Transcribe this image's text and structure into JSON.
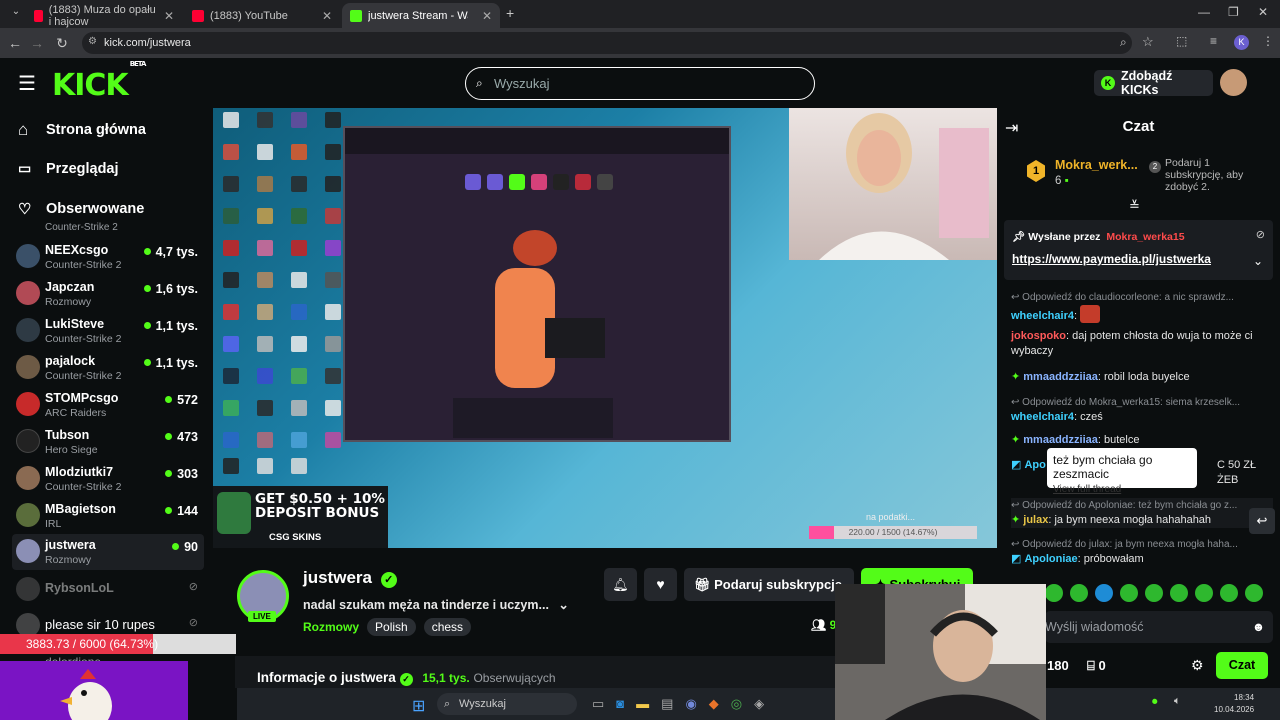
{
  "browser": {
    "tabs": [
      {
        "title": "(1883) Muza do opału i hajcow",
        "favicon_color": "#ff0033"
      },
      {
        "title": "(1883) YouTube",
        "favicon_color": "#ff0033"
      },
      {
        "title": "justwera Stream - Watch Li",
        "favicon_color": "#53fc18",
        "active": true
      }
    ],
    "url": "kick.com/justwera",
    "profile_letter": "K"
  },
  "header": {
    "logo": "KICK",
    "logo_badge": "BETA",
    "search_placeholder": "Wyszukaj",
    "get_kicks": "Zdobądź KICKs"
  },
  "sidebar": {
    "nav": [
      {
        "label": "Strona główna",
        "icon": "home-icon"
      },
      {
        "label": "Przeglądaj",
        "icon": "browse-icon"
      },
      {
        "label": "Obserwowane",
        "icon": "heart-icon"
      }
    ],
    "partial_top": "Counter-Strike 2",
    "channels": [
      {
        "name": "NEEXcsgo",
        "category": "Counter-Strike 2",
        "viewers": "4,7 tys.",
        "color": "#3a5068"
      },
      {
        "name": "Japczan",
        "category": "Rozmowy",
        "viewers": "1,6 tys.",
        "color": "#b14a55"
      },
      {
        "name": "LukiSteve",
        "category": "Counter-Strike 2",
        "viewers": "1,1 tys.",
        "color": "#2e3a44"
      },
      {
        "name": "pajalock",
        "category": "Counter-Strike 2",
        "viewers": "1,1 tys.",
        "color": "#6d5a45"
      },
      {
        "name": "STOMPcsgo",
        "category": "ARC Raiders",
        "viewers": "572",
        "color": "#c72a2a"
      },
      {
        "name": "Tubson",
        "category": "Hero Siege",
        "viewers": "473",
        "color": "#222"
      },
      {
        "name": "Mlodziutki7",
        "category": "Counter-Strike 2",
        "viewers": "303",
        "color": "#8a6a52"
      },
      {
        "name": "MBagietson",
        "category": "IRL",
        "viewers": "144",
        "color": "#5a6d3b"
      },
      {
        "name": "justwera",
        "category": "Rozmowy",
        "viewers": "90",
        "color": "#8b8fb5",
        "active": true
      }
    ],
    "offline": [
      {
        "name": "RybsonLoL"
      },
      {
        "name": "please sir 10 rupes"
      },
      {
        "name": "delordione"
      }
    ]
  },
  "video": {
    "sub_goal": "220.00 / 1500 (14.67%)",
    "sub_goal_label": "na podatki...",
    "sub_goal_fraction": 0.1467,
    "bonus_text": "GET $0.50 + 10% DEPOSIT BONUS",
    "bonus_brand": "CSG SKINS"
  },
  "stream": {
    "name": "justwera",
    "title": "nadal szukam męża na tinderze i uczym...",
    "tags": [
      "Rozmowy",
      "Polish",
      "chess"
    ],
    "live": "LIVE",
    "gift_sub": "Podaruj subskrypcje",
    "subscribe": "Subskrybuj",
    "viewers_partial": "9",
    "about_title": "Informacje o justwera",
    "followers": "15,1 tys.",
    "followers_label": "Obserwujących"
  },
  "chat": {
    "title": "Czat",
    "top_gifter_rank": "1",
    "top_gifter": "Mokra_werk...",
    "top_gifter_count": "6",
    "gift_prompt": "Podaruj 1 subskrypcję, aby zdobyć 2.",
    "pinned_by_label": "Wysłane przez",
    "pinned_by": "Mokra_werka15",
    "pinned_link": "https://www.paymedia.pl/justwerka",
    "messages": [
      {
        "reply": "Odpowiedź do claudiocorleone: a nic sprawdz...",
        "user": "wheelchair4",
        "color": "#3fd1ff",
        "text": ""
      },
      {
        "user": "jokospoko",
        "color": "#ff5a5a",
        "text": "daj potem chłosta do wuja to może ci wybaczy"
      },
      {
        "user": "mmaaddzziiaa",
        "color": "#8ab4ff",
        "text": "robil loda buyelce"
      },
      {
        "reply": "Odpowiedź do Mokra_werka15: siema krzeselk...",
        "user": "wheelchair4",
        "color": "#3fd1ff",
        "text": "cześ"
      },
      {
        "user": "mmaaddzziiaa",
        "color": "#8ab4ff",
        "text": "butelce"
      },
      {
        "user": "Apo",
        "color": "#3fd1ff",
        "text": "C 50 ZŁ ŻEB"
      },
      {
        "reply": "Odpowiedź do Apoloniae: też bym chciała go z...",
        "user": "julax",
        "color": "#e8c547",
        "text": "ja bym neexa mogła hahahahah"
      },
      {
        "reply": "Odpowiedź do julax: ja bym neexa mogła haha...",
        "user": "Apoloniae",
        "color": "#3fd1ff",
        "text": "próbowałam"
      }
    ],
    "tooltip": "też bym chciała go zeszmacic",
    "tooltip_link": "View full thread",
    "input_placeholder": "Wyślij wiadomość",
    "points": "180",
    "gifts": "0",
    "send": "Czat"
  },
  "overlay": {
    "progress": "3883.73 / 6000 (64.73%)",
    "progress_fraction": 0.6473
  },
  "taskbar": {
    "search": "Wyszukaj",
    "time": "18:34",
    "date": "10.04.2026"
  }
}
